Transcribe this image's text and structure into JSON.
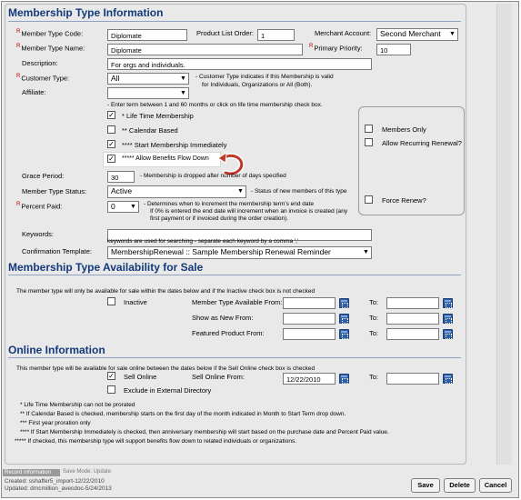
{
  "type_info": {
    "title": "Membership Type Information",
    "code_label": "Member Type Code:",
    "code_value": "Diplomate",
    "order_label": "Product List Order:",
    "order_value": "1",
    "merchant_label": "Merchant Account:",
    "merchant_value": "Second Merchant",
    "name_label": "Member Type Name:",
    "name_value": "Diplomate",
    "priority_label": "Primary Priority:",
    "priority_value": "10",
    "desc_label": "Description:",
    "desc_value": "For orgs and individuals.",
    "customer_type_label": "Customer Type:",
    "customer_type_value": "All",
    "customer_type_hint1": "- Customer Type indicates if this Membership is valid",
    "customer_type_hint2": "for Individuals, Organizations or All (Both).",
    "affiliate_label": "Affiliate:",
    "affiliate_value": "",
    "term_hint": "- Enter term between 1 and 60 months or click on life time membership check box.",
    "lifetime_label": "* Life Time Membership",
    "calendar_label": "** Calendar Based",
    "start_immediately_label": "**** Start Membership Immediately",
    "benefits_label": "***** Allow Benefits Flow Down",
    "members_only_label": "Members Only",
    "recurring_label": "Allow Recurring Renewal?",
    "force_renew_label": "Force Renew?",
    "grace_label": "Grace Period:",
    "grace_value": "30",
    "grace_hint": "- Membership is dropped after number of days specified",
    "status_label": "Member Type Status:",
    "status_value": "Active",
    "status_hint": "- Status of new members of this type",
    "percent_label": "Percent Paid:",
    "percent_value": "0",
    "percent_hint1": "- Determines when to increment the membership term's end date",
    "percent_hint2": "If 0% is entered the end date will increment when an invoice is created (any",
    "percent_hint3": "first payment or if invoiced during the order creation).",
    "keywords_label": "Keywords:",
    "keywords_value": "",
    "keywords_hint": "keywords are used for searching - separate each keyword by a comma ','",
    "confirmation_label": "Confirmation Template:",
    "confirmation_value": "MembershipRenewal :: Sample Membership Renewal Reminder"
  },
  "availability": {
    "title": "Membership Type Availability for Sale",
    "description": "The member type will only be available for sale within the dates below and if the Inactive check box is not checked",
    "inactive_label": "Inactive",
    "available_from_label": "Member Type Available From:",
    "available_from_value": "",
    "new_from_label": "Show as New From:",
    "new_from_value": "",
    "featured_from_label": "Featured Product From:",
    "featured_from_value": "",
    "to_label": "To:"
  },
  "online": {
    "title": "Online Information",
    "description": "This member type will be available for sale online between the dates below if the Sell Online check box is checked",
    "sell_online_label": "Sell Online",
    "exclude_label": "Exclude in External Directory",
    "sell_from_label": "Sell Online From:",
    "sell_from_value": "12/22/2010",
    "to_label": "To:",
    "to_value": ""
  },
  "notes": [
    "* Life Time Membership can not be prorated",
    "** If Calendar Based is checked, membership starts on the first day of the month indicated in Month to Start Term drop down.",
    "*** First year proration only",
    "**** If Start Membership Immediately is checked, then anniversary membership will start based on the purchase date and Percent Paid value.",
    "***** If checked, this membership type will support benefits flow down to related individuals or organizations."
  ],
  "footer": {
    "record_tab": "Record Information",
    "save_mode": "Save Mode: Update",
    "created": "Created:  sshaffer5_import-12/22/2010",
    "updated": "Updated:  dmcmillion_avecdoc-5/24/2013",
    "save_button": "Save",
    "delete_button": "Delete",
    "cancel_button": "Cancel"
  },
  "colors": {
    "section_title": "#143a7a",
    "required_marker": "#c00000",
    "panel_bg": "#e9e9e9",
    "callout_arrow": "#c0392b"
  },
  "icons": [
    "calendar-icon",
    "checkbox-checked",
    "dropdown-arrow",
    "callout-arrow-icon"
  ]
}
